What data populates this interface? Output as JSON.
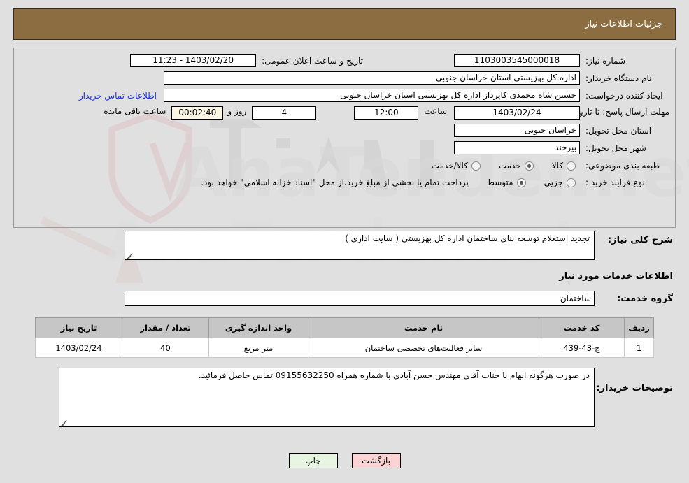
{
  "colors": {
    "header_bg": "#8c6d42",
    "page_bg": "#e0e0e0",
    "link": "#1a35d8",
    "table_header_bg": "#c6c6c6",
    "timer_bg": "#fbf7e4",
    "print_btn_bg": "#e8f5e2",
    "back_btn_bg": "#fad4d4"
  },
  "header": {
    "title": "جزئیات اطلاعات نیاز"
  },
  "watermark": {
    "text": "AnaTender.net"
  },
  "form": {
    "need_number_label": "شماره نیاز:",
    "need_number_value": "1103003545000018",
    "announce_label": "تاریخ و ساعت اعلان عمومی:",
    "announce_value": "1403/02/20 - 11:23",
    "buyer_org_label": "نام دستگاه خریدار:",
    "buyer_org_value": "اداره کل بهزیستی استان خراسان جنوبی",
    "creator_label": "ایجاد کننده درخواست:",
    "creator_value": "حسین شاه محمدی کاپرداز اداره کل بهزیستی استان خراسان جنوبی",
    "contact_link": "اطلاعات تماس خریدار",
    "deadline_label": "مهلت ارسال پاسخ: تا تاریخ:",
    "deadline_date": "1403/02/24",
    "hour_label": "ساعت",
    "hour_value": "12:00",
    "days_value": "4",
    "days_label": "روز و",
    "timer_value": "00:02:40",
    "timer_label": "ساعت باقی مانده",
    "province_label": "استان محل تحویل:",
    "province_value": "خراسان جنوبی",
    "city_label": "شهر محل تحویل:",
    "city_value": "بیرجند",
    "category_label": "طبقه بندی موضوعی:",
    "category_options": [
      {
        "label": "کالا",
        "selected": false
      },
      {
        "label": "خدمت",
        "selected": true
      },
      {
        "label": "کالا/خدمت",
        "selected": false
      }
    ],
    "process_label": "نوع فرآیند خرید :",
    "process_options": [
      {
        "label": "جزیی",
        "selected": false
      },
      {
        "label": "متوسط",
        "selected": true
      }
    ],
    "payment_note": "پرداخت تمام یا بخشی از مبلغ خرید،از محل \"اسناد خزانه اسلامی\" خواهد بود."
  },
  "description": {
    "label": "شرح کلی نیاز:",
    "value": "تجدید استعلام توسعه بنای ساختمان اداره کل بهزیستی ( سایت اداری )"
  },
  "services": {
    "section_title": "اطلاعات خدمات مورد نیاز",
    "group_label": "گروه خدمت:",
    "group_value": "ساختمان",
    "table": {
      "columns": [
        "ردیف",
        "کد خدمت",
        "نام خدمت",
        "واحد اندازه گیری",
        "تعداد / مقدار",
        "تاریخ نیاز"
      ],
      "rows": [
        {
          "row": "1",
          "code": "ج-43-439",
          "name": "سایر فعالیت‌های تخصصی ساختمان",
          "unit": "متر مربع",
          "qty": "40",
          "date": "1403/02/24"
        }
      ]
    }
  },
  "notes": {
    "label": "توضیحات خریدار:",
    "value": "در صورت هرگونه ابهام با جناب آقای مهندس حسن آبادی با شماره همراه 09155632250 تماس حاصل فرمائید."
  },
  "buttons": {
    "print": "چاپ",
    "back": "بازگشت"
  }
}
